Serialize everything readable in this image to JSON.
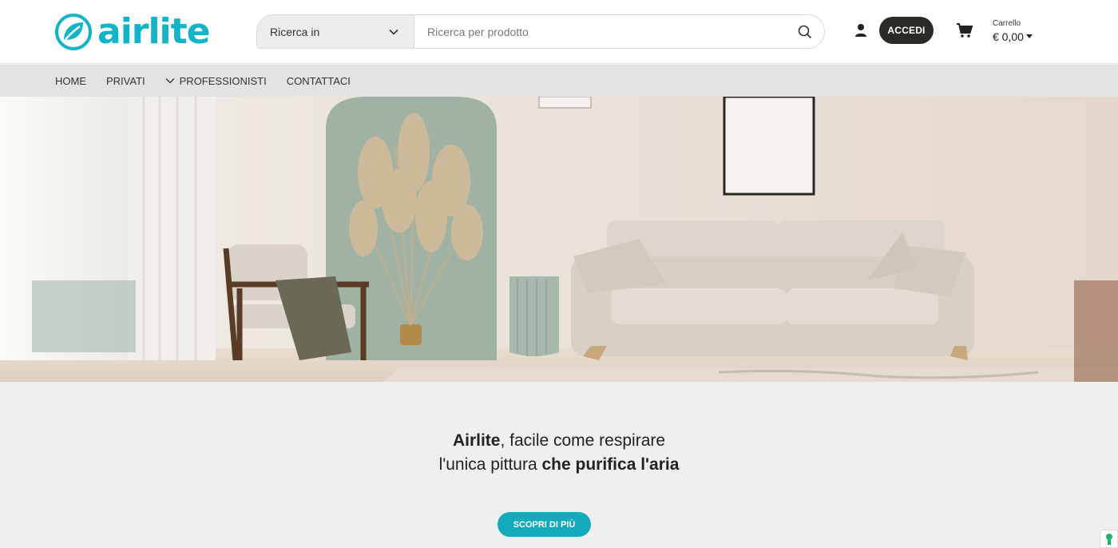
{
  "brand": {
    "name": "airlite",
    "color": "#12b5c8"
  },
  "search": {
    "category_label": "Ricerca in",
    "placeholder": "Ricerca per prodotto",
    "value": ""
  },
  "header": {
    "login_label": "ACCEDI",
    "cart_label": "Carrello",
    "cart_total": "€ 0,00"
  },
  "nav": {
    "items": [
      {
        "label": "HOME",
        "icon": null
      },
      {
        "label": "PRIVATI",
        "icon": null
      },
      {
        "label": "PROFESSIONISTI",
        "icon": "chevron-down-icon"
      },
      {
        "label": "CONTATTACI",
        "icon": null
      }
    ]
  },
  "hero": {
    "image": "living-room-photo"
  },
  "tagline": {
    "line1_bold": "Airlite",
    "line1_rest": ", facile come respirare",
    "line2_regular": "l'unica pittura ",
    "line2_bold": "che purifica l'aria"
  },
  "cta": {
    "label": "SCOPRI DI PIÙ",
    "color": "#13aabb"
  },
  "colors": {
    "login_bg": "#2b2b25",
    "nav_bg": "#e3e3e1",
    "page_bg": "#efefef"
  }
}
